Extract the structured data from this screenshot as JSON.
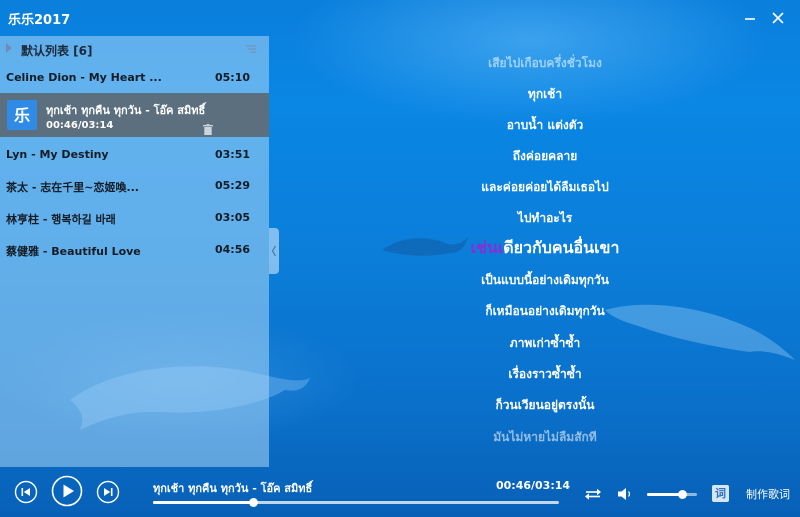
{
  "app": {
    "title": "乐乐2017"
  },
  "playlist": {
    "title": "默认列表 [6]",
    "tracks": [
      {
        "title": "Celine Dion - My Heart ...",
        "duration": "05:10"
      },
      {
        "title": "ทุกเช้า ทุกคืน ทุกวัน - โอ๊ค สมิทธิ์",
        "position": "00:46/03:14"
      },
      {
        "title": "Lyn - My Destiny",
        "duration": "03:51"
      },
      {
        "title": "茶太 - 志在千里~恋姬喚...",
        "duration": "05:29"
      },
      {
        "title": "林亨柱 - 행복하길 바래",
        "duration": "03:05"
      },
      {
        "title": "蔡健雅 - Beautiful Love",
        "duration": "04:56"
      }
    ],
    "art_glyph": "乐"
  },
  "lyrics": {
    "lines": [
      "เสียไปเกือบครึ่งชั่วโมง",
      "ทุกเช้า",
      "อาบน้ำ แต่งตัว",
      "ถึงค่อยคลาย",
      "และค่อยค่อยได้ลืมเธอไป",
      "ไปทำอะไร",
      "",
      "เป็นแบบนี้อย่างเดิมทุกวัน",
      "ก็เหมือนอย่างเดิมทุกวัน",
      "ภาพเก่าซ้ำซ้ำ",
      "เรื่องราวซ้ำซ้ำ",
      "ก็วนเวียนอยู่ตรงนั้น",
      "มันไม่หายไม่ลืมสักที"
    ],
    "current_sung": "เช่นเ",
    "current_rest": "ดียวกับคนอื่นเขา"
  },
  "player": {
    "now_playing": "ทุกเช้า ทุกคืน ทุกวัน - โอ๊ค สมิทธิ์",
    "time": "00:46/03:14",
    "progress": 0.247,
    "volume": 0.7,
    "lyric_button": "词",
    "make_lyric": "制作歌词"
  },
  "colors": {
    "background": "#0a86e4",
    "lyric_highlight": "#8b2cd8",
    "active_row": "#5c6f7f"
  },
  "icons": {
    "minimize": "minimize-icon",
    "close": "close-icon",
    "prev": "previous-icon",
    "play": "play-icon",
    "next": "next-icon",
    "repeat": "repeat-icon",
    "volume": "volume-icon",
    "menu": "list-menu-icon",
    "trash": "trash-icon"
  }
}
